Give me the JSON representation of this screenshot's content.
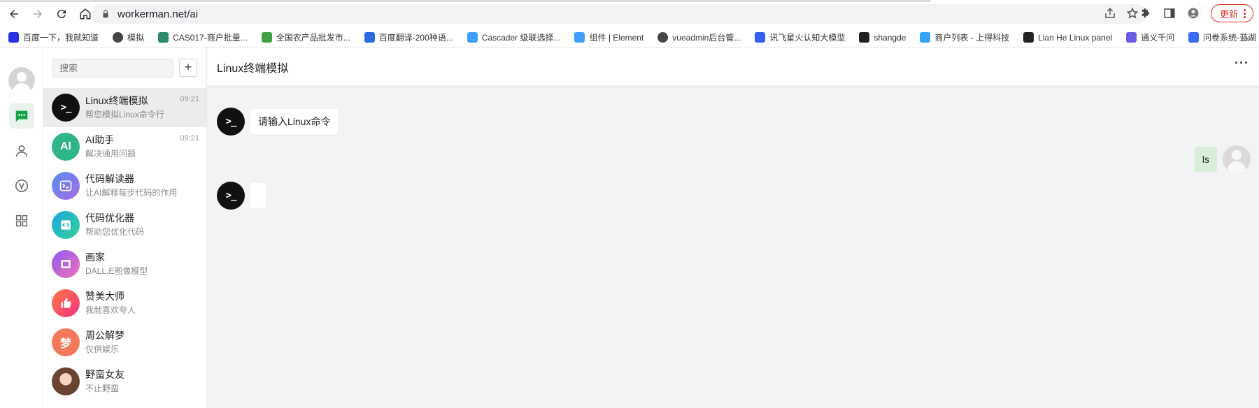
{
  "browser": {
    "url": "workerman.net/ai",
    "update_label": "更新"
  },
  "bookmarks": [
    {
      "label": "百度一下，我就知道",
      "icon": "baidu-paw-icon",
      "color": "#2932e1"
    },
    {
      "label": "模拟",
      "icon": "globe-icon",
      "color": "#444444"
    },
    {
      "label": "CAS017-商户批量...",
      "icon": "cas-icon",
      "color": "#2a8c6b"
    },
    {
      "label": "全国农产品批发市...",
      "icon": "market-icon",
      "color": "#43a047"
    },
    {
      "label": "百度翻译-200种语...",
      "icon": "translate-icon",
      "color": "#2b6de1"
    },
    {
      "label": "Cascader 级联选择...",
      "icon": "element-icon",
      "color": "#409eff"
    },
    {
      "label": "组件 | Element",
      "icon": "element-icon",
      "color": "#409eff"
    },
    {
      "label": "vueadmin后台管...",
      "icon": "globe-icon",
      "color": "#444444"
    },
    {
      "label": "讯飞星火认知大模型",
      "icon": "spark-icon",
      "color": "#3460f1"
    },
    {
      "label": "shangde",
      "icon": "bt-icon",
      "color": "#222222"
    },
    {
      "label": "商户列表 - 上得科技",
      "icon": "shangde-icon",
      "color": "#36a3f7"
    },
    {
      "label": "Lian He Linux panel",
      "icon": "bt-icon",
      "color": "#222222"
    },
    {
      "label": "通义千问",
      "icon": "tongyi-icon",
      "color": "#6b5ce7"
    },
    {
      "label": "问卷系统-蓝湖",
      "icon": "lanhu-icon",
      "color": "#3b6cf6"
    }
  ],
  "sidebar": {
    "search_placeholder": "搜索",
    "add_label": "+"
  },
  "conversations": [
    {
      "title": "Linux终端模拟",
      "subtitle": "帮您模拟Linux命令行",
      "time": "09:21",
      "avatar": "terminal-icon",
      "color": "#111111",
      "active": true
    },
    {
      "title": "AI助手",
      "subtitle": "解决通用问题",
      "time": "09:21",
      "avatar": "ai-icon",
      "avatar_text": "AI",
      "color": "#2fb58a"
    },
    {
      "title": "代码解读器",
      "subtitle": "让AI解释每步代码的作用",
      "time": "",
      "avatar": "code-terminal-icon",
      "color": "#7a7be8"
    },
    {
      "title": "代码优化器",
      "subtitle": "帮助您优化代码",
      "time": "",
      "avatar": "code-icon",
      "color": "#22b5c9"
    },
    {
      "title": "画家",
      "subtitle": "DALL.E图像模型",
      "time": "",
      "avatar": "painter-icon",
      "color": "#b35ad1"
    },
    {
      "title": "赞美大师",
      "subtitle": "我就喜欢夸人",
      "time": "",
      "avatar": "thumbs-up-icon",
      "color": "#f2556a"
    },
    {
      "title": "周公解梦",
      "subtitle": "仅供娱乐",
      "time": "",
      "avatar": "dream-icon",
      "avatar_text": "梦",
      "color": "#f27a5b"
    },
    {
      "title": "野蛮女友",
      "subtitle": "不止野蛮",
      "time": "",
      "avatar": "girl-photo-icon",
      "color": "#c99a86"
    }
  ],
  "chat": {
    "title": "Linux终端模拟",
    "more_label": "···",
    "messages": [
      {
        "role": "assistant",
        "text": "请输入Linux命令"
      },
      {
        "role": "user",
        "text": "ls"
      },
      {
        "role": "assistant",
        "text": ""
      }
    ]
  }
}
